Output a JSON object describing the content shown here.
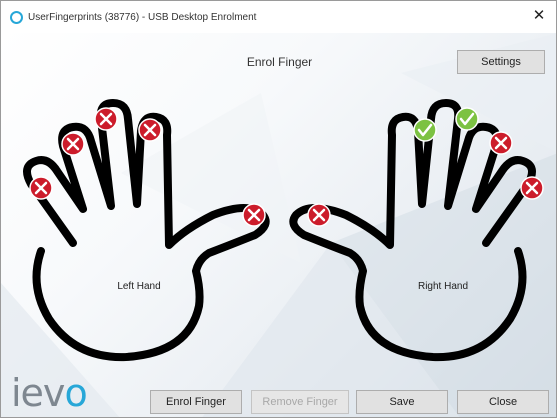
{
  "window": {
    "title": "UserFingerprints (38776) - USB Desktop Enrolment"
  },
  "header": {
    "title": "Enrol Finger",
    "settings_label": "Settings"
  },
  "hands": {
    "left_label": "Left Hand",
    "right_label": "Right Hand",
    "fingers": {
      "left_pinky": "not-enrolled",
      "left_ring": "not-enrolled",
      "left_middle": "not-enrolled",
      "left_index": "not-enrolled",
      "left_thumb": "not-enrolled",
      "right_thumb": "not-enrolled",
      "right_index": "enrolled",
      "right_middle": "enrolled",
      "right_ring": "not-enrolled",
      "right_pinky": "not-enrolled"
    }
  },
  "footer": {
    "logo_text_main": "iev",
    "logo_text_accent": "o",
    "enrol_label": "Enrol Finger",
    "remove_label": "Remove Finger",
    "save_label": "Save",
    "close_label": "Close"
  },
  "colors": {
    "not_enrolled": "#cc1c2b",
    "enrolled": "#7cc242",
    "accent": "#27a7d8"
  }
}
